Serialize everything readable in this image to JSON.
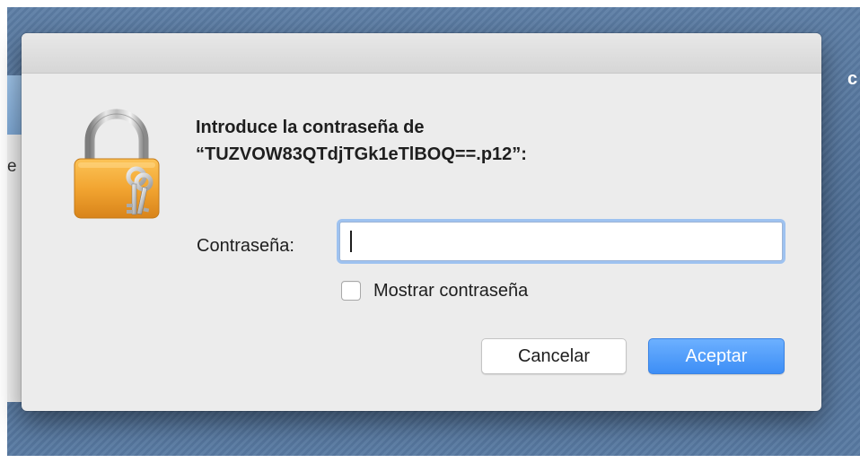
{
  "background": {
    "partial_text_right": "c",
    "partial_text_left": "e"
  },
  "dialog": {
    "message_line1": "Introduce la contraseña de",
    "message_line2": "“TUZVOW83QTdjTGk1eTlBOQ==.p12”:",
    "password_label": "Contraseña:",
    "password_value": "",
    "show_password_label": "Mostrar contraseña",
    "show_password_checked": false,
    "cancel_label": "Cancelar",
    "accept_label": "Aceptar",
    "icon": "keychain-lock-icon"
  },
  "colors": {
    "accent": "#3d8ef6",
    "dialog_bg": "#ececec",
    "lock_body": "#f2a531",
    "desktop": "#5d7ea5"
  }
}
